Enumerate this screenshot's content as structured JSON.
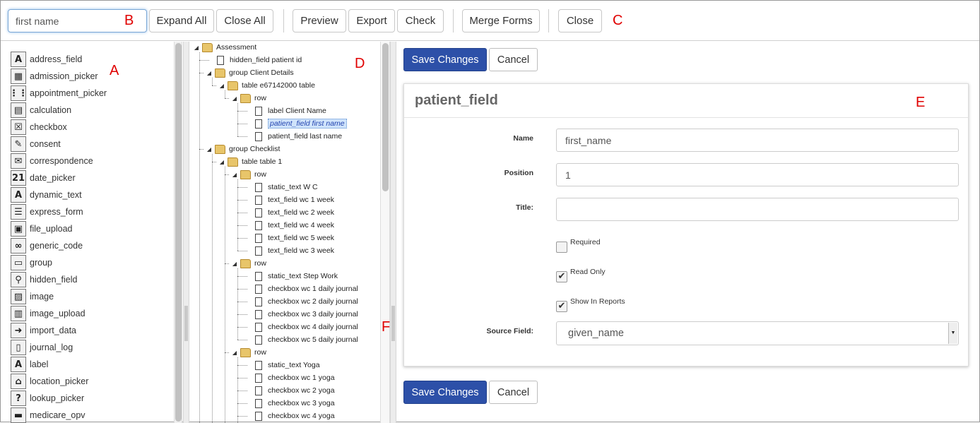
{
  "toolbar": {
    "search_value": "first name",
    "expand_all": "Expand All",
    "close_all": "Close All",
    "preview": "Preview",
    "export": "Export",
    "check": "Check",
    "merge_forms": "Merge Forms",
    "close": "Close"
  },
  "markers": {
    "a": "A",
    "b": "B",
    "c": "C",
    "d": "D",
    "e": "E",
    "f": "F"
  },
  "palette": {
    "items": [
      {
        "label": "address_field",
        "icon": "address-field-icon",
        "glyph": "A"
      },
      {
        "label": "admission_picker",
        "icon": "admission-calendar-icon",
        "glyph": "▦"
      },
      {
        "label": "appointment_picker",
        "icon": "appointment-grid-icon",
        "glyph": "⋮⋮"
      },
      {
        "label": "calculation",
        "icon": "calculator-icon",
        "glyph": "▤"
      },
      {
        "label": "checkbox",
        "icon": "checkbox-icon",
        "glyph": "☒"
      },
      {
        "label": "consent",
        "icon": "pencil-icon",
        "glyph": "✎"
      },
      {
        "label": "correspondence",
        "icon": "envelope-icon",
        "glyph": "✉"
      },
      {
        "label": "date_picker",
        "icon": "calendar-icon",
        "glyph": "21"
      },
      {
        "label": "dynamic_text",
        "icon": "dynamic-text-icon",
        "glyph": "A"
      },
      {
        "label": "express_form",
        "icon": "form-list-icon",
        "glyph": "☰"
      },
      {
        "label": "file_upload",
        "icon": "box-upload-icon",
        "glyph": "▣"
      },
      {
        "label": "generic_code",
        "icon": "binoculars-icon",
        "glyph": "∞"
      },
      {
        "label": "group",
        "icon": "group-window-icon",
        "glyph": "▭"
      },
      {
        "label": "hidden_field",
        "icon": "magnifier-icon",
        "glyph": "⚲"
      },
      {
        "label": "image",
        "icon": "image-icon",
        "glyph": "▨"
      },
      {
        "label": "image_upload",
        "icon": "image-upload-icon",
        "glyph": "▥"
      },
      {
        "label": "import_data",
        "icon": "import-arrow-icon",
        "glyph": "➜"
      },
      {
        "label": "journal_log",
        "icon": "journal-icon",
        "glyph": "▯"
      },
      {
        "label": "label",
        "icon": "label-letter-icon",
        "glyph": "A"
      },
      {
        "label": "location_picker",
        "icon": "house-icon",
        "glyph": "⌂"
      },
      {
        "label": "lookup_picker",
        "icon": "question-icon",
        "glyph": "?"
      },
      {
        "label": "medicare_opv",
        "icon": "card-icon",
        "glyph": "▬"
      }
    ]
  },
  "tree": {
    "nodes": [
      {
        "label": "Assessment",
        "type": "folder",
        "depth": 0,
        "toggle": true
      },
      {
        "label": "hidden_field patient id",
        "type": "file",
        "depth": 1,
        "toggle": false
      },
      {
        "label": "group Client Details",
        "type": "folder",
        "depth": 1,
        "toggle": true
      },
      {
        "label": "table e67142000 table",
        "type": "folder",
        "depth": 2,
        "toggle": true
      },
      {
        "label": "row",
        "type": "folder",
        "depth": 3,
        "toggle": true
      },
      {
        "label": "label Client Name",
        "type": "file",
        "depth": 4,
        "toggle": false
      },
      {
        "label": "patient_field first name",
        "type": "file",
        "depth": 4,
        "toggle": false,
        "selected": true
      },
      {
        "label": "patient_field last name",
        "type": "file",
        "depth": 4,
        "toggle": false
      },
      {
        "label": "group Checklist",
        "type": "folder",
        "depth": 1,
        "toggle": true
      },
      {
        "label": "table table 1",
        "type": "folder",
        "depth": 2,
        "toggle": true
      },
      {
        "label": "row",
        "type": "folder",
        "depth": 3,
        "toggle": true
      },
      {
        "label": "static_text W C",
        "type": "file",
        "depth": 4,
        "toggle": false
      },
      {
        "label": "text_field wc 1 week",
        "type": "file",
        "depth": 4,
        "toggle": false
      },
      {
        "label": "text_field wc 2 week",
        "type": "file",
        "depth": 4,
        "toggle": false
      },
      {
        "label": "text_field wc 4 week",
        "type": "file",
        "depth": 4,
        "toggle": false
      },
      {
        "label": "text_field wc 5 week",
        "type": "file",
        "depth": 4,
        "toggle": false
      },
      {
        "label": "text_field wc 3 week",
        "type": "file",
        "depth": 4,
        "toggle": false
      },
      {
        "label": "row",
        "type": "folder",
        "depth": 3,
        "toggle": true
      },
      {
        "label": "static_text Step Work",
        "type": "file",
        "depth": 4,
        "toggle": false
      },
      {
        "label": "checkbox wc 1 daily journal",
        "type": "file",
        "depth": 4,
        "toggle": false
      },
      {
        "label": "checkbox wc 2 daily journal",
        "type": "file",
        "depth": 4,
        "toggle": false
      },
      {
        "label": "checkbox wc 3 daily journal",
        "type": "file",
        "depth": 4,
        "toggle": false
      },
      {
        "label": "checkbox wc 4 daily journal",
        "type": "file",
        "depth": 4,
        "toggle": false
      },
      {
        "label": "checkbox wc 5 daily journal",
        "type": "file",
        "depth": 4,
        "toggle": false
      },
      {
        "label": "row",
        "type": "folder",
        "depth": 3,
        "toggle": true
      },
      {
        "label": "static_text Yoga",
        "type": "file",
        "depth": 4,
        "toggle": false
      },
      {
        "label": "checkbox wc 1 yoga",
        "type": "file",
        "depth": 4,
        "toggle": false
      },
      {
        "label": "checkbox wc 2 yoga",
        "type": "file",
        "depth": 4,
        "toggle": false
      },
      {
        "label": "checkbox wc 3 yoga",
        "type": "file",
        "depth": 4,
        "toggle": false
      },
      {
        "label": "checkbox wc 4 yoga",
        "type": "file",
        "depth": 4,
        "toggle": false
      }
    ]
  },
  "editor": {
    "save_changes": "Save Changes",
    "cancel": "Cancel",
    "panel_title": "patient_field",
    "name_label": "Name",
    "name_value": "first_name",
    "position_label": "Position",
    "position_value": "1",
    "title_label": "Title:",
    "title_value": "",
    "required_label": "Required",
    "required_checked": false,
    "read_only_label": "Read Only",
    "read_only_checked": true,
    "show_in_reports_label": "Show In Reports",
    "show_in_reports_checked": true,
    "source_field_label": "Source Field:",
    "source_field_value": "given_name"
  },
  "colors": {
    "primary_button": "#2d50a8",
    "marker": "#e00000",
    "selection": "#cfe3fb"
  }
}
